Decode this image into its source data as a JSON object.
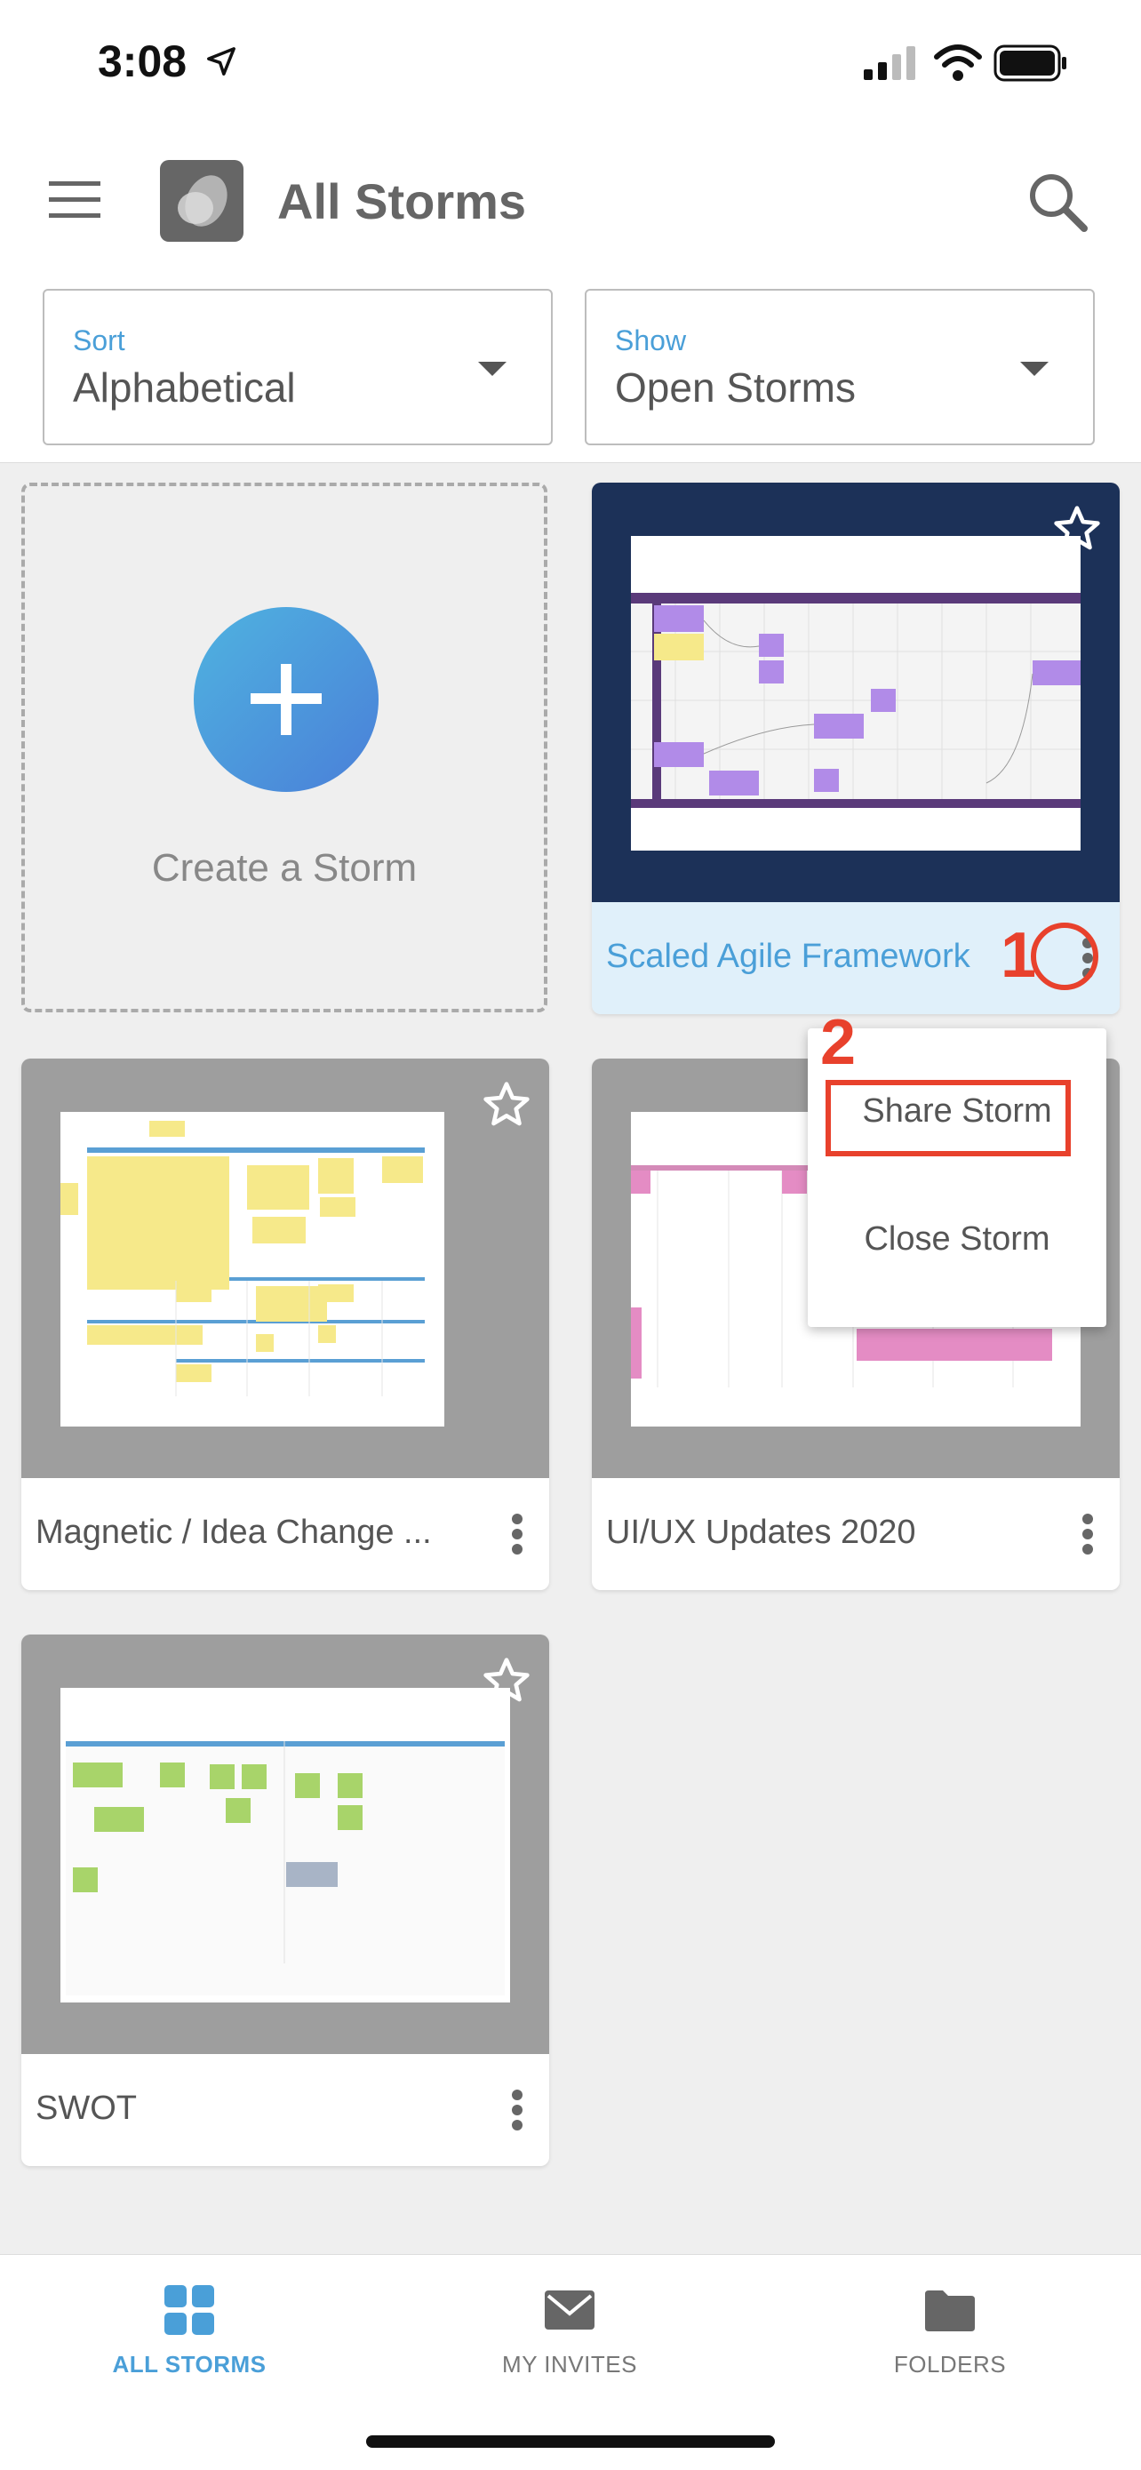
{
  "status": {
    "time": "3:08"
  },
  "header": {
    "title": "All Storms"
  },
  "filters": {
    "sort": {
      "label": "Sort",
      "value": "Alphabetical"
    },
    "show": {
      "label": "Show",
      "value": "Open Storms"
    }
  },
  "create_card": {
    "label": "Create a Storm"
  },
  "storms": [
    {
      "title": "Scaled Agile Framework",
      "selected": true
    },
    {
      "title": "Magnetic / Idea Change ..."
    },
    {
      "title": "UI/UX Updates 2020"
    },
    {
      "title": "SWOT"
    }
  ],
  "context_menu": {
    "items": [
      "Share Storm",
      "Close Storm"
    ]
  },
  "annotations": [
    "1",
    "2"
  ],
  "tabbar": {
    "items": [
      {
        "label": "ALL STORMS",
        "icon": "grid-icon",
        "active": true
      },
      {
        "label": "MY INVITES",
        "icon": "envelope-icon"
      },
      {
        "label": "FOLDERS",
        "icon": "folder-icon"
      }
    ]
  },
  "colors": {
    "accent": "#4a9fd8",
    "annotation": "#e8412c",
    "selected_card": "#1c3158"
  }
}
